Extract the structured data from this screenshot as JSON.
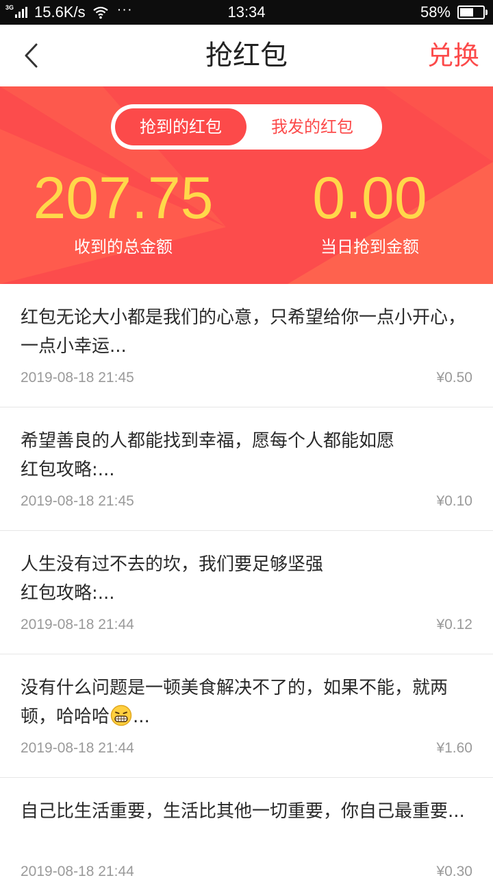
{
  "status_bar": {
    "network": "3G",
    "speed": "15.6K/s",
    "more": "···",
    "time": "13:34",
    "battery_text": "58%",
    "battery_level": 0.58
  },
  "nav": {
    "title": "抢红包",
    "action": "兑换",
    "back_icon": "chevron-left-icon"
  },
  "tabs": {
    "active": "抢到的红包",
    "inactive": "我发的红包"
  },
  "stats": {
    "total_value": "207.75",
    "total_label": "收到的总金额",
    "today_value": "0.00",
    "today_label": "当日抢到金额"
  },
  "colors": {
    "accent": "#fc4a4a",
    "hero_bg": "#fc4c4c",
    "stat_value": "#ffd84a",
    "text": "#2a2a2a",
    "muted": "#9a9a9a"
  },
  "items": [
    {
      "text": "红包无论大小都是我们的心意，只希望给你一点小开心，一点小幸运...",
      "time": "2019-08-18 21:45",
      "amount": "¥0.50"
    },
    {
      "text": "希望善良的人都能找到幸福，愿每个人都能如愿",
      "text2": "红包攻略:...",
      "time": "2019-08-18 21:45",
      "amount": "¥0.10"
    },
    {
      "text": "人生没有过不去的坎，我们要足够坚强",
      "text2": "红包攻略:...",
      "time": "2019-08-18 21:44",
      "amount": "¥0.12"
    },
    {
      "text": "没有什么问题是一顿美食解决不了的，如果不能，就两顿，哈哈哈",
      "text_tail": "...",
      "time": "2019-08-18 21:44",
      "amount": "¥1.60"
    },
    {
      "text": "自己比生活重要，生活比其他一切重要，你自己最重要...",
      "time": "2019-08-18 21:44",
      "amount": "¥0.30"
    }
  ]
}
